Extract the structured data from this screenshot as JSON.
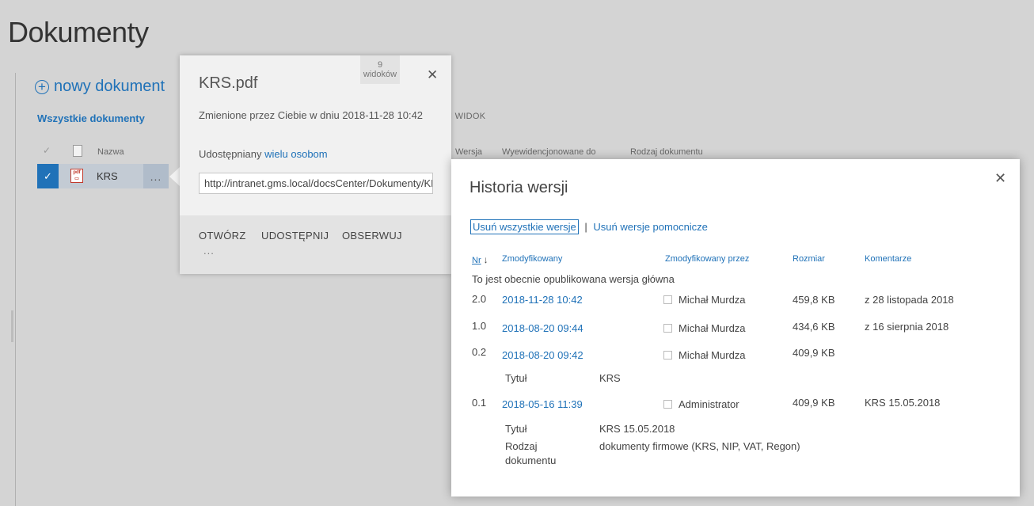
{
  "page": {
    "title": "Dokumenty"
  },
  "toolbar": {
    "new_document": "nowy dokument"
  },
  "views": {
    "all_documents": "Wszystkie dokumenty",
    "new_view_suffix": "N WIDOK"
  },
  "columns": {
    "name": "Nazwa",
    "version": "Wersja",
    "checked_out_to": "Wyewidencjonowane do",
    "document_type": "Rodzaj dokumentu"
  },
  "list": {
    "rows": [
      {
        "name": "KRS",
        "menu": "..."
      }
    ]
  },
  "callout": {
    "title": "KRS.pdf",
    "views_count": "9",
    "views_label": "widoków",
    "changed": "Zmienione przez Ciebie w dniu 2018-11-28 10:42",
    "shared_prefix": "Udostępniany",
    "shared_link": "wielu osobom",
    "url": "http://intranet.gms.local/docsCenter/Dokumenty/KRS.pdf",
    "actions": {
      "open": "OTWÓRZ",
      "share": "UDOSTĘPNIJ",
      "follow": "OBSERWUJ",
      "more": "..."
    }
  },
  "dialog": {
    "title": "Historia wersji",
    "delete_all": "Usuń wszystkie wersje",
    "separator": "|",
    "delete_minor": "Usuń wersje pomocnicze",
    "headers": {
      "nr": "Nr",
      "modified": "Zmodyfikowany",
      "modified_by": "Zmodyfikowany przez",
      "size": "Rozmiar",
      "comments": "Komentarze"
    },
    "published_note": "To jest obecnie opublikowana wersja główna",
    "versions": [
      {
        "nr": "2.0",
        "modified": "2018-11-28 10:42",
        "by": "Michał Murdza",
        "size": "459,8 KB",
        "comment": "z 28 listopada 2018"
      },
      {
        "nr": "1.0",
        "modified": "2018-08-20 09:44",
        "by": "Michał Murdza",
        "size": "434,6 KB",
        "comment": "z 16 sierpnia 2018"
      },
      {
        "nr": "0.2",
        "modified": "2018-08-20 09:42",
        "by": "Michał Murdza",
        "size": "409,9 KB",
        "comment": ""
      },
      {
        "nr": "0.1",
        "modified": "2018-05-16 11:39",
        "by": "Administrator",
        "size": "409,9 KB",
        "comment": "KRS 15.05.2018"
      }
    ],
    "properties": {
      "title_label": "Tytuł",
      "v02_title": "KRS",
      "v01_title": "KRS 15.05.2018",
      "doc_type_label_1": "Rodzaj",
      "doc_type_label_2": "dokumentu",
      "v01_doc_type": "dokumenty firmowe (KRS, NIP, VAT, Regon)"
    }
  }
}
